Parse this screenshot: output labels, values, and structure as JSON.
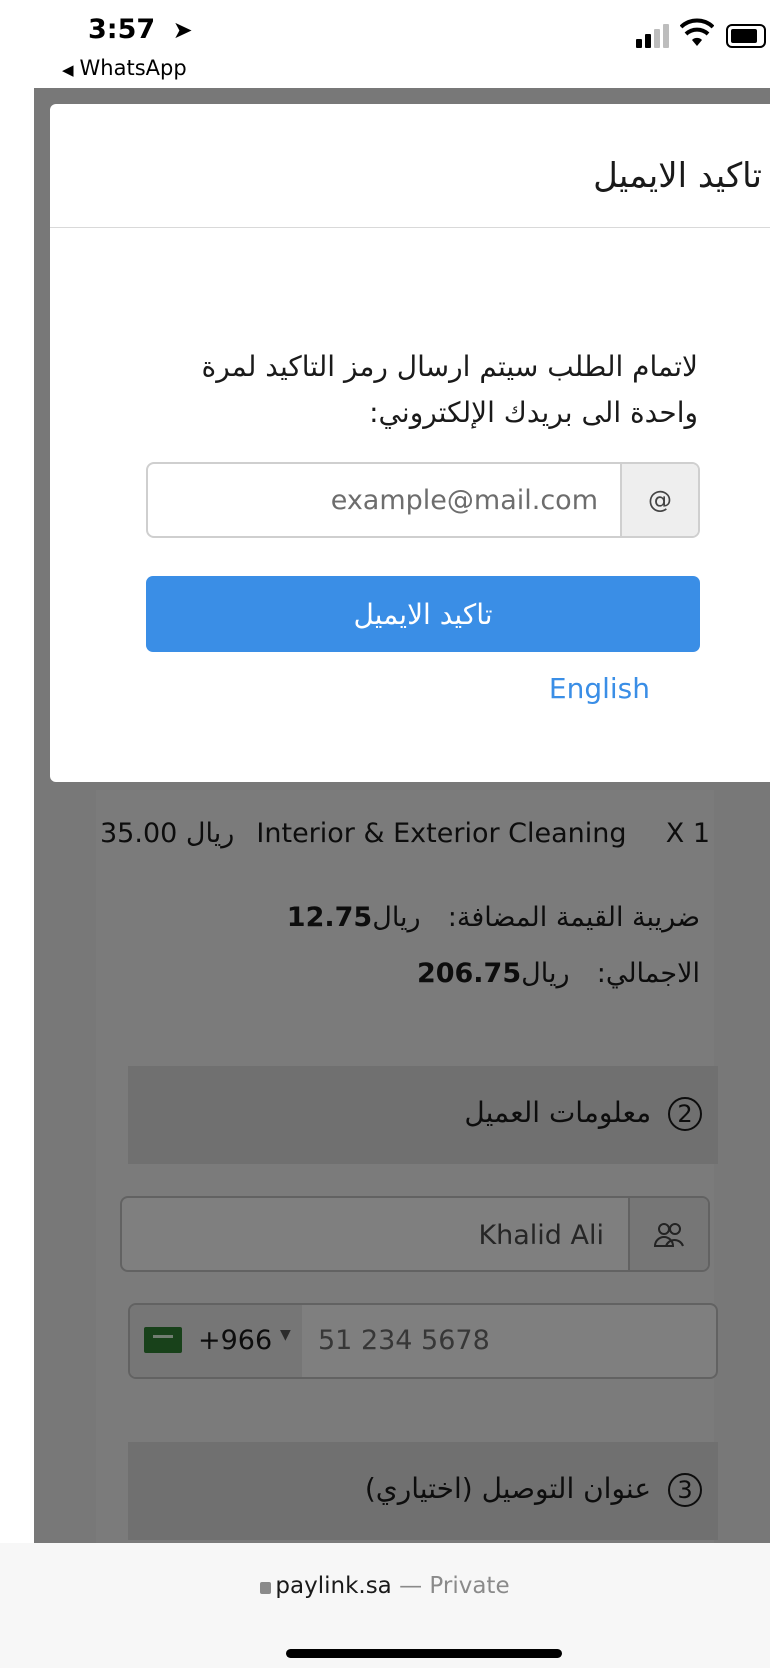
{
  "status_bar": {
    "time": "3:57",
    "back_app": "WhatsApp"
  },
  "modal": {
    "title": "تاكيد الايميل",
    "message": "لاتمام الطلب سيتم ارسال رمز التاكيد لمرة واحدة الى بريدك الإلكتروني:",
    "email_placeholder": "example@mail.com",
    "at_symbol": "@",
    "confirm_button": "تاكيد الايميل",
    "language_link": "English"
  },
  "order": {
    "item_qty": "X 1",
    "item_name": "Interior & Exterior Cleaning",
    "item_price": "35.00 ريال",
    "vat_label": "ضريبة القيمة المضافة:",
    "vat_value": "12.75",
    "currency": "ريال",
    "total_label": "الاجمالي:",
    "total_value": "206.75"
  },
  "customer_section": {
    "number": "2",
    "title": "معلومات العميل",
    "name_value": "Khalid Ali",
    "phone_code": "+966",
    "phone_placeholder": "51 234 5678"
  },
  "delivery_section": {
    "number": "3",
    "title": "عنوان التوصيل (اختياري)"
  },
  "browser": {
    "domain": "paylink.sa",
    "separator": "—",
    "mode": "Private"
  },
  "colors": {
    "accent": "#3a8ee6",
    "flag_green": "#2f7d32"
  }
}
